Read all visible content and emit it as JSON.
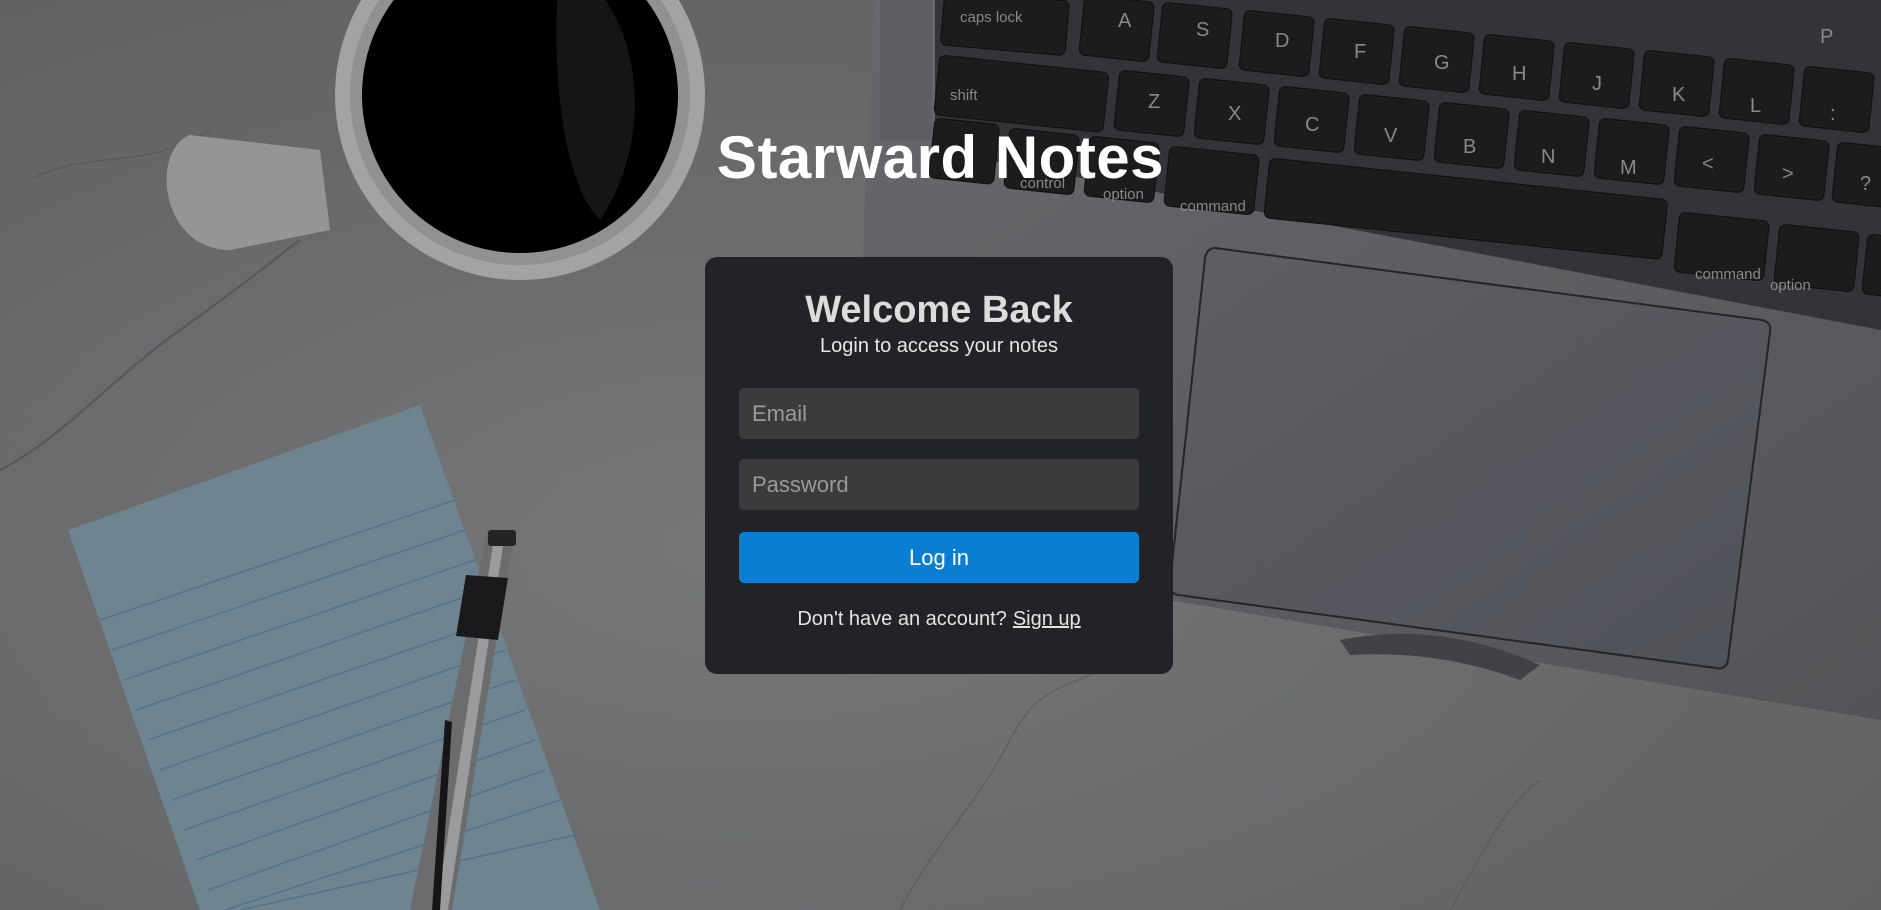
{
  "app": {
    "title": "Starward Notes"
  },
  "login_card": {
    "title": "Welcome Back",
    "subtitle": "Login to access your notes",
    "email_placeholder": "Email",
    "email_value": "",
    "password_placeholder": "Password",
    "password_value": "",
    "login_button_label": "Log in",
    "signup_prompt": "Don't have an account?",
    "signup_link_label": "Sign up"
  },
  "background": {
    "description_icons": [
      "coffee-mug",
      "laptop-keyboard",
      "trackpad",
      "notepad",
      "pen"
    ],
    "keyboard_keys_row1": [
      "caps lock",
      "A",
      "S",
      "D",
      "F",
      "G",
      "H",
      "J",
      "K",
      "L",
      ":",
      "P"
    ],
    "keyboard_keys_row2": [
      "shift",
      "Z",
      "X",
      "C",
      "V",
      "B",
      "N",
      "M",
      "<",
      ">",
      "?"
    ],
    "keyboard_keys_row3": [
      "control",
      "option",
      "command",
      "command",
      "option"
    ],
    "colors": {
      "overlay": "#6f7173",
      "card": "#222326",
      "input": "#3b3b3d",
      "accent": "#0a7fd1"
    }
  }
}
